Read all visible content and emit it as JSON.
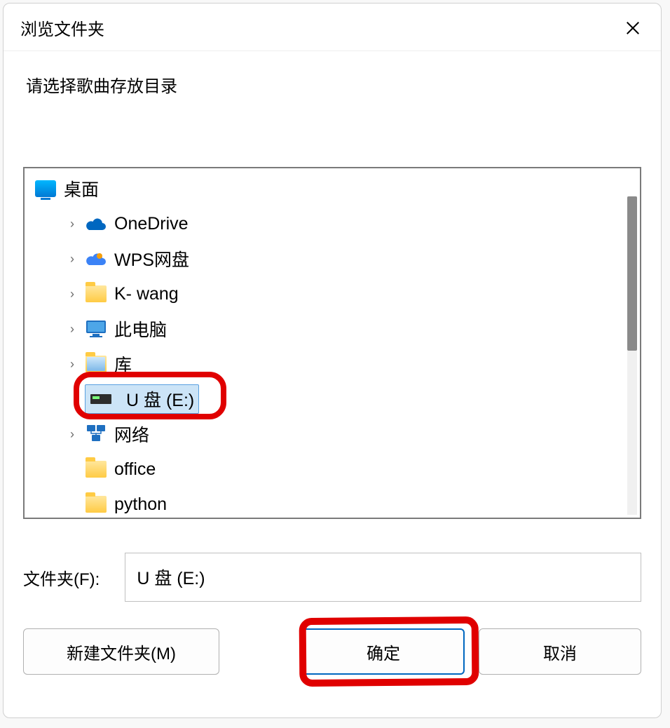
{
  "dialog": {
    "title": "浏览文件夹",
    "prompt": "请选择歌曲存放目录"
  },
  "tree": {
    "root": {
      "label": "桌面",
      "icon": "desktop"
    },
    "items": [
      {
        "label": "OneDrive",
        "icon": "cloud-blue",
        "expandable": true
      },
      {
        "label": "WPS网盘",
        "icon": "cloud-multi",
        "expandable": true
      },
      {
        "label": "K- wang",
        "icon": "folder",
        "expandable": true
      },
      {
        "label": "此电脑",
        "icon": "pc",
        "expandable": true
      },
      {
        "label": "库",
        "icon": "folder-lib",
        "expandable": true
      },
      {
        "label": "U 盘 (E:)",
        "icon": "usb",
        "expandable": false,
        "selected": true
      },
      {
        "label": "网络",
        "icon": "network",
        "expandable": true
      },
      {
        "label": "office",
        "icon": "folder",
        "expandable": false
      },
      {
        "label": "python",
        "icon": "folder",
        "expandable": false
      }
    ]
  },
  "folderField": {
    "label": "文件夹(F):",
    "value": "U 盘 (E:)"
  },
  "buttons": {
    "newFolder": "新建文件夹(M)",
    "ok": "确定",
    "cancel": "取消"
  }
}
